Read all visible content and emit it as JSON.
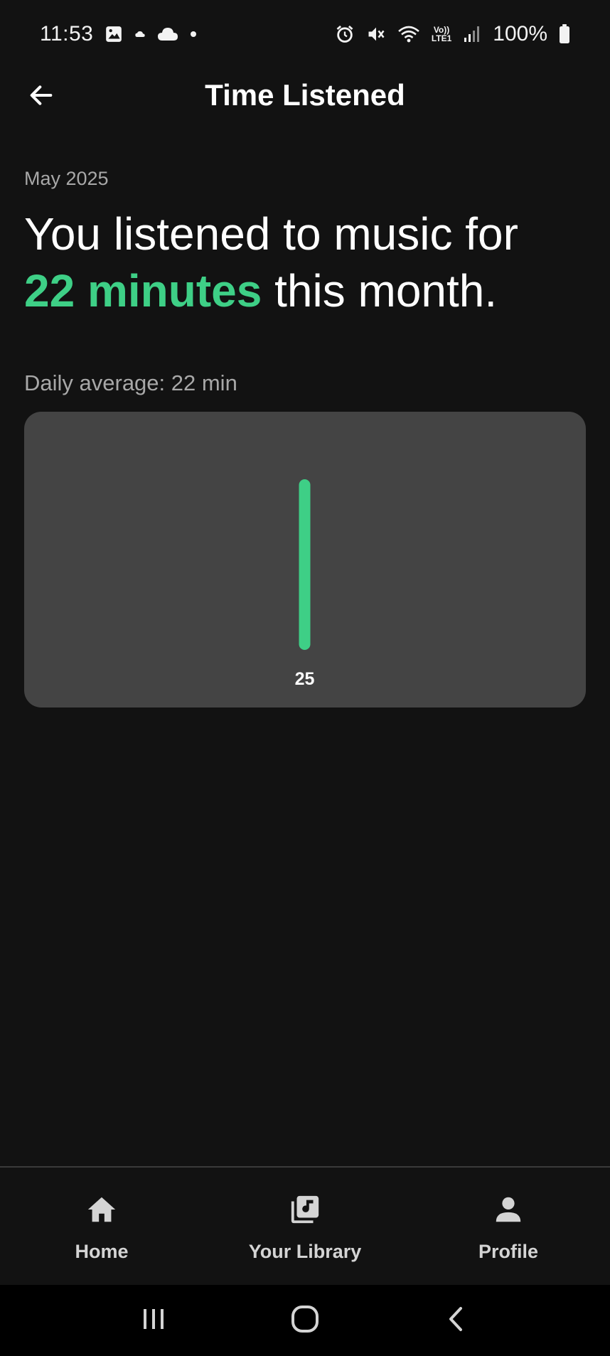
{
  "status_bar": {
    "time": "11:53",
    "battery_percent": "100%",
    "lte_top": "Vo))",
    "lte_bottom": "LTE1",
    "icons": [
      "image-icon",
      "cloud-small-icon",
      "cloud-icon",
      "dot-icon",
      "alarm-icon",
      "mute-icon",
      "wifi-icon",
      "lte-icon",
      "signal-icon",
      "battery-icon"
    ]
  },
  "header": {
    "title": "Time Listened",
    "back_icon": "arrow-left-icon"
  },
  "main": {
    "month": "May 2025",
    "headline_prefix": "You listened to music for",
    "headline_highlight": "22 minutes",
    "headline_suffix": " this month.",
    "daily_average": "Daily average: 22 min"
  },
  "chart_data": {
    "type": "bar",
    "categories": [
      "25"
    ],
    "values": [
      22
    ],
    "title": "",
    "xlabel": "",
    "ylabel": "",
    "ylim": [
      0,
      22
    ],
    "grid": false,
    "bar_color": "#3ecf86",
    "background": "#444444"
  },
  "bottom_nav": {
    "items": [
      {
        "label": "Home",
        "icon": "home-icon"
      },
      {
        "label": "Your Library",
        "icon": "library-icon"
      },
      {
        "label": "Profile",
        "icon": "profile-icon"
      }
    ]
  },
  "system_nav": {
    "icons": [
      "recent-apps-icon",
      "home-circle-icon",
      "back-chevron-icon"
    ]
  },
  "colors": {
    "accent": "#3ecf86",
    "background": "#121212",
    "card": "#444444",
    "muted_text": "#a8a8a8"
  }
}
